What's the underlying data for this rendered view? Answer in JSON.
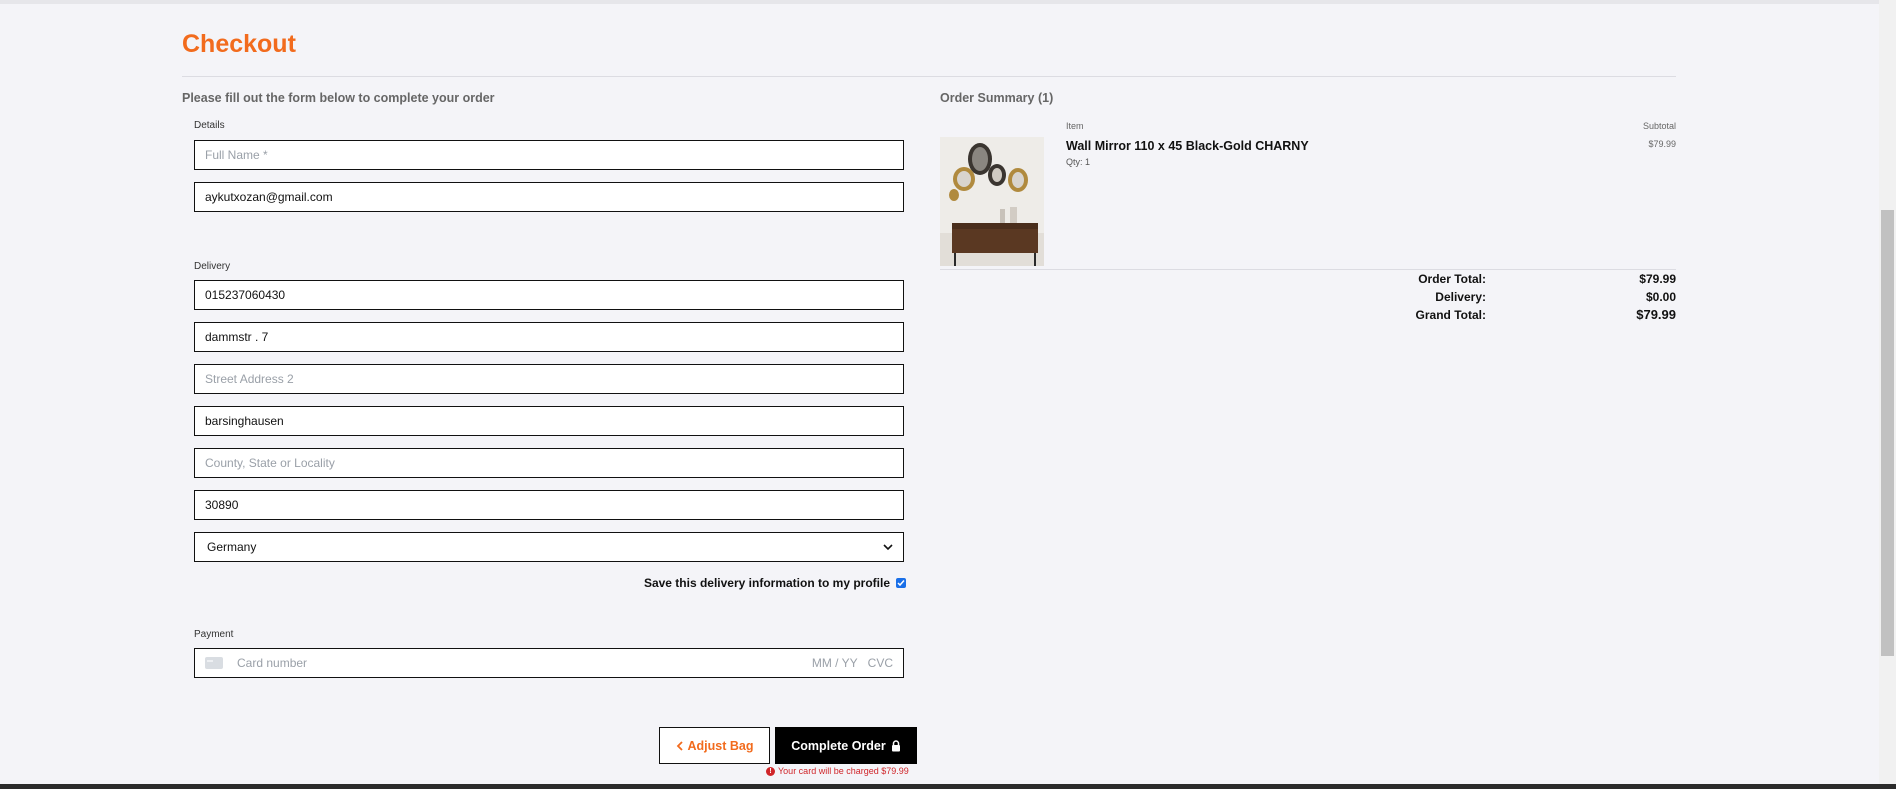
{
  "page": {
    "title": "Checkout"
  },
  "form": {
    "intro": "Please fill out the form below to complete your order",
    "details_label": "Details",
    "full_name": {
      "value": "",
      "placeholder": "Full Name *"
    },
    "email": {
      "value": "aykutxozan@gmail.com"
    },
    "delivery_label": "Delivery",
    "phone": {
      "value": "015237060430"
    },
    "street1": {
      "value": "dammstr . 7"
    },
    "street2": {
      "value": "",
      "placeholder": "Street Address 2"
    },
    "city": {
      "value": "barsinghausen"
    },
    "county": {
      "value": "",
      "placeholder": "County, State or Locality"
    },
    "postcode": {
      "value": "30890"
    },
    "country": {
      "selected": "Germany"
    },
    "save_info": {
      "label": "Save this delivery information to my profile",
      "checked": true
    },
    "payment_label": "Payment",
    "card": {
      "number_placeholder": "Card number",
      "expiry_placeholder": "MM / YY",
      "cvc_placeholder": "CVC"
    }
  },
  "actions": {
    "adjust_label": "Adjust Bag",
    "complete_label": "Complete Order",
    "charge_note": "Your card will be charged $79.99"
  },
  "summary": {
    "title": "Order Summary (1)",
    "col_item": "Item",
    "col_subtotal": "Subtotal",
    "items": [
      {
        "name": "Wall Mirror 110 x 45 Black-Gold CHARNY",
        "qty": "Qty: 1",
        "price": "$79.99"
      }
    ],
    "order_total_label": "Order Total:",
    "order_total": "$79.99",
    "delivery_label": "Delivery:",
    "delivery": "$0.00",
    "grand_total_label": "Grand Total:",
    "grand_total": "$79.99"
  },
  "colors": {
    "accent": "#f26b1d",
    "error": "#d0262a",
    "checkbox": "#1a6fe8"
  }
}
